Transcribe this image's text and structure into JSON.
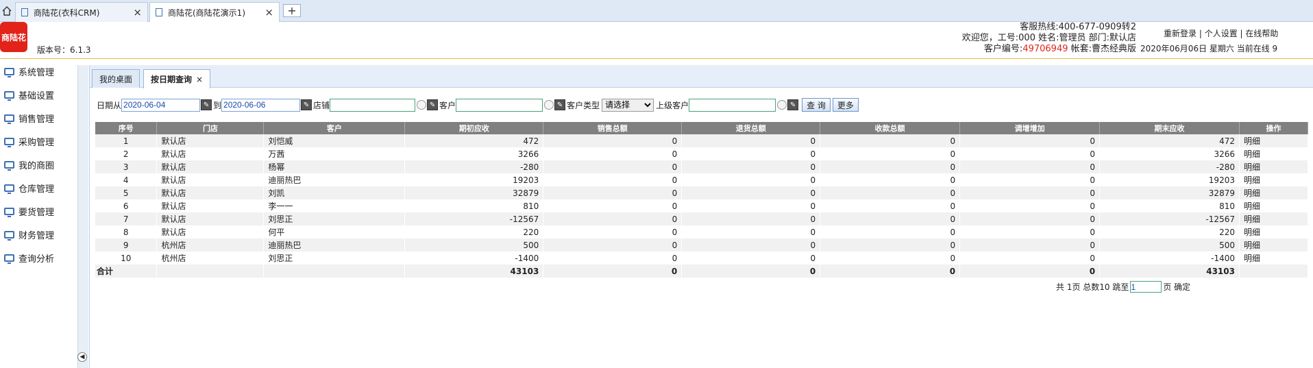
{
  "browser": {
    "tabs": [
      {
        "title": "商陆花(衣科CRM)"
      },
      {
        "title": "商陆花(商陆花演示1)"
      }
    ],
    "close_glyph": "×",
    "new_tab_glyph": "+"
  },
  "header": {
    "logo_text": "商陆花",
    "version": "版本号：6.1.3",
    "hotline": "客服热线:400-677-0909转2",
    "welcome": "欢迎您，工号:000 姓名:管理员 部门:默认店",
    "customer_no_label": "客户编号:",
    "customer_no": "49706949",
    "account": " 帐套:曹杰经典版",
    "links": [
      "重新登录",
      "个人设置",
      "在线帮助"
    ],
    "separator": " | ",
    "date_line": "2020年06月06日 星期六 当前在线 9"
  },
  "sidebar": {
    "items": [
      "系统管理",
      "基础设置",
      "销售管理",
      "采购管理",
      "我的商圈",
      "仓库管理",
      "要货管理",
      "财务管理",
      "查询分析"
    ]
  },
  "content_tabs": [
    {
      "label": "我的桌面"
    },
    {
      "label": "按日期查询",
      "close": "×"
    }
  ],
  "filters": {
    "date_from_label": "日期从",
    "date_from": "2020-06-04",
    "to_label": "到",
    "date_to": "2020-06-06",
    "store_label": "店铺",
    "customer_label": "客户",
    "customer_type_label": "客户类型",
    "customer_type_value": "请选择",
    "parent_customer_label": "上级客户",
    "search_button": "查 询",
    "more_button": "更多"
  },
  "table": {
    "columns": [
      "序号",
      "门店",
      "客户",
      "期初应收",
      "销售总额",
      "退货总额",
      "收款总额",
      "调增增加",
      "期末应收",
      "操作"
    ],
    "rows": [
      [
        "1",
        "默认店",
        "刘恺威",
        "472",
        "0",
        "0",
        "0",
        "0",
        "472",
        "明细"
      ],
      [
        "2",
        "默认店",
        "万茜",
        "3266",
        "0",
        "0",
        "0",
        "0",
        "3266",
        "明细"
      ],
      [
        "3",
        "默认店",
        "杨幂",
        "-280",
        "0",
        "0",
        "0",
        "0",
        "-280",
        "明细"
      ],
      [
        "4",
        "默认店",
        "迪丽热巴",
        "19203",
        "0",
        "0",
        "0",
        "0",
        "19203",
        "明细"
      ],
      [
        "5",
        "默认店",
        "刘凯",
        "32879",
        "0",
        "0",
        "0",
        "0",
        "32879",
        "明细"
      ],
      [
        "6",
        "默认店",
        "李一一",
        "810",
        "0",
        "0",
        "0",
        "0",
        "810",
        "明细"
      ],
      [
        "7",
        "默认店",
        "刘思正",
        "-12567",
        "0",
        "0",
        "0",
        "0",
        "-12567",
        "明细"
      ],
      [
        "8",
        "默认店",
        "何平",
        "220",
        "0",
        "0",
        "0",
        "0",
        "220",
        "明细"
      ],
      [
        "9",
        "杭州店",
        "迪丽热巴",
        "500",
        "0",
        "0",
        "0",
        "0",
        "500",
        "明细"
      ],
      [
        "10",
        "杭州店",
        "刘思正",
        "-1400",
        "0",
        "0",
        "0",
        "0",
        "-1400",
        "明细"
      ]
    ],
    "total": [
      "合计",
      "",
      "",
      "43103",
      "0",
      "0",
      "0",
      "0",
      "43103",
      ""
    ]
  },
  "pager": {
    "summary": "共 1页 总数10 跳至",
    "page_value": "1",
    "suffix": "页 确定"
  },
  "colors": {
    "accent": "#3c6fb3",
    "brand_red": "#e2231a",
    "header_line": "#e9b84a",
    "grid_header": "#808080"
  }
}
